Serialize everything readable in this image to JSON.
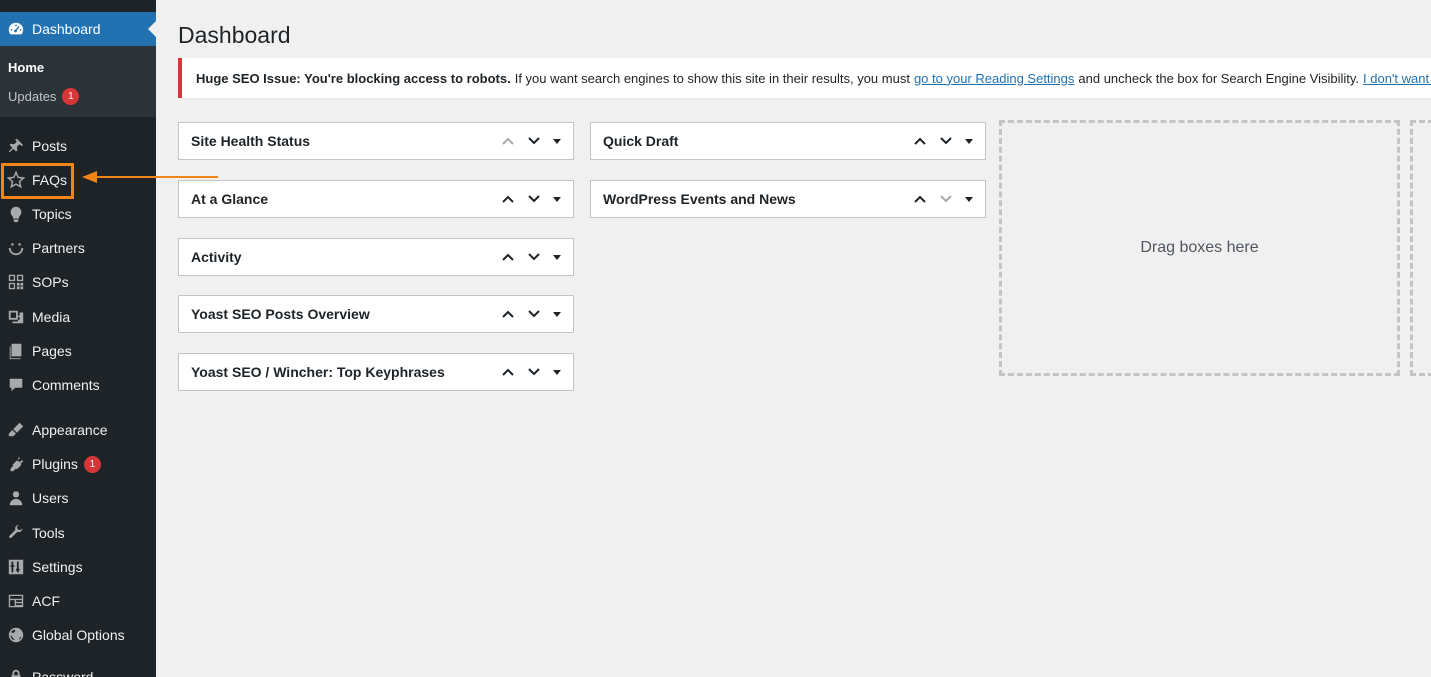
{
  "sidebar": {
    "dashboard": "Dashboard",
    "submenu": {
      "home": "Home",
      "updates": "Updates",
      "updates_count": "1"
    },
    "items": [
      {
        "label": "Posts",
        "icon": "pin-icon"
      },
      {
        "label": "FAQs",
        "icon": "star-icon"
      },
      {
        "label": "Topics",
        "icon": "lightbulb-icon"
      },
      {
        "label": "Partners",
        "icon": "smiley-icon"
      },
      {
        "label": "SOPs",
        "icon": "grid-icon"
      },
      {
        "label": "Media",
        "icon": "media-icon"
      },
      {
        "label": "Pages",
        "icon": "pages-icon"
      },
      {
        "label": "Comments",
        "icon": "comment-icon"
      },
      {
        "label": "Appearance",
        "icon": "brush-icon"
      },
      {
        "label": "Plugins",
        "icon": "plugin-icon",
        "badge": "1"
      },
      {
        "label": "Users",
        "icon": "user-icon"
      },
      {
        "label": "Tools",
        "icon": "wrench-icon"
      },
      {
        "label": "Settings",
        "icon": "settings-icon"
      },
      {
        "label": "ACF",
        "icon": "table-icon"
      },
      {
        "label": "Global Options",
        "icon": "globe-icon"
      },
      {
        "label": "Password",
        "icon": "lock-icon"
      }
    ]
  },
  "main": {
    "title": "Dashboard",
    "notice": {
      "strong": "Huge SEO Issue: You're blocking access to robots.",
      "text1": "If you want search engines to show this site in their results, you must",
      "link": "go to your Reading Settings",
      "text2": "and uncheck the box for Search Engine Visibility.",
      "link2": "I don't want this site to show in the search results."
    },
    "widgets_col1": [
      "Site Health Status",
      "At a Glance",
      "Activity",
      "Yoast SEO Posts Overview",
      "Yoast SEO / Wincher: Top Keyphrases"
    ],
    "widgets_col2": [
      "Quick Draft",
      "WordPress Events and News"
    ],
    "drop_zone": "Drag boxes here"
  },
  "colors": {
    "sidebar_bg": "#1d2327",
    "accent": "#2271b1",
    "highlight": "#f0851a",
    "badge": "#d63638"
  }
}
